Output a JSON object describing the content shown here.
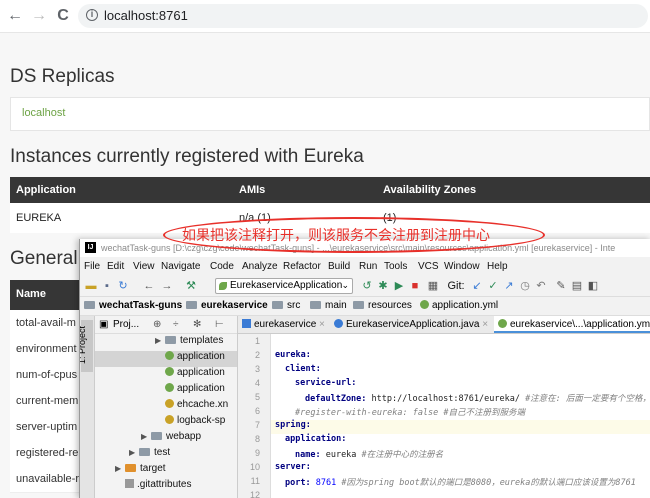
{
  "browser": {
    "back": "←",
    "forward": "→",
    "reload": "C",
    "info": "i",
    "url": "localhost:8761"
  },
  "eureka": {
    "replicas_title": "DS Replicas",
    "replica_host": "localhost",
    "instances_title": "Instances currently registered with Eureka",
    "instances_columns": [
      "Application",
      "AMIs",
      "Availability Zones"
    ],
    "instance_row": {
      "application": "EUREKA",
      "amis": "n/a (1)",
      "zones": "(1)"
    },
    "general_title": "General",
    "general_header": "Name",
    "general_rows": [
      "total-avail-m",
      "environment",
      "num-of-cpus",
      "current-mem",
      "server-uptim",
      "registered-re",
      "unavailable-r"
    ]
  },
  "annotation": {
    "text": "如果把该注释打开，则该服务不会注册到注册中心",
    "color": "#e8302a"
  },
  "ide": {
    "logo": "IJ",
    "title": "wechatTask-guns [D:\\czg\\czg\\code\\wechatTask-guns] - ...\\eurekaservice\\src\\main\\resources\\application.yml [eurekaservice] - Inte",
    "menu": [
      "File",
      "Edit",
      "View",
      "Navigate",
      "Code",
      "Analyze",
      "Refactor",
      "Build",
      "Run",
      "Tools",
      "VCS",
      "Window",
      "Help"
    ],
    "run_config": "EurekaserviceApplication",
    "git_label": "Git:",
    "breadcrumbs": [
      "wechatTask-guns",
      "eurekaservice",
      "src",
      "main",
      "resources",
      "application.yml"
    ],
    "project_tab": "1: Project",
    "project_label": "Proj...",
    "tree": [
      {
        "label": "templates",
        "type": "folder"
      },
      {
        "label": "application",
        "type": "yml",
        "selected": true
      },
      {
        "label": "application",
        "type": "yml"
      },
      {
        "label": "application",
        "type": "yml"
      },
      {
        "label": "ehcache.xn",
        "type": "xml"
      },
      {
        "label": "logback-sp",
        "type": "xml"
      },
      {
        "label": "webapp",
        "type": "folder"
      },
      {
        "label": "test",
        "type": "folder"
      },
      {
        "label": "target",
        "type": "folder-orange"
      },
      {
        "label": ".gitattributes",
        "type": "file"
      }
    ],
    "editor_tabs": [
      "eurekaservice",
      "EurekaserviceApplication.java",
      "eurekaservice\\...\\application.yml"
    ],
    "line_numbers": [
      "1",
      "2",
      "3",
      "4",
      "5",
      "6",
      "7",
      "8",
      "9",
      "10",
      "11",
      "12"
    ],
    "code": {
      "l2": "eureka:",
      "l3": "client:",
      "l4": "service-url:",
      "l5_key": "defaultZone:",
      "l5_val": " http://localhost:8761/eureka/ ",
      "l5_cmt": "#注意在: 后面一定要有个空格，否则",
      "l6_cmt": "#register-with-eureka: false ",
      "l6_txt": "#自己不注册到服务端",
      "l7": "spring:",
      "l8": "application:",
      "l9_key": "name:",
      "l9_val": " eureka ",
      "l9_cmt": "#在注册中心的注册名",
      "l10": "server:",
      "l11_key": "port:",
      "l11_val": " 8761 ",
      "l11_cmt": "#因为spring boot默认的端口是8080，eureka的默认端口应该设置为8761"
    }
  }
}
